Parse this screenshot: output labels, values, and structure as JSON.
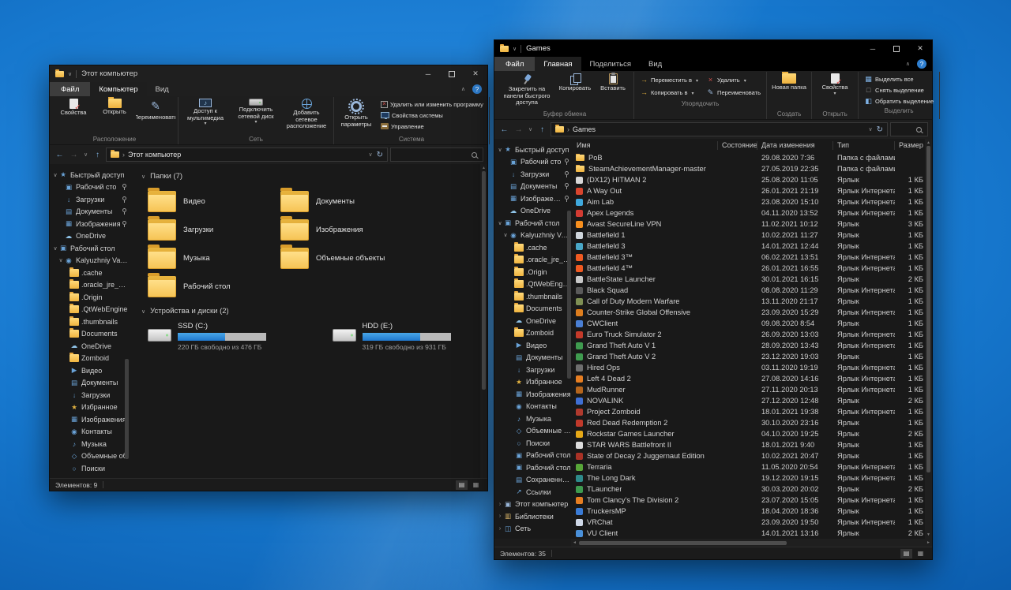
{
  "icons": {
    "back": "←",
    "forward": "→",
    "up": "↑",
    "chevron_down": "∨",
    "chevron_up": "∧",
    "breadcrumb": "›",
    "refresh": "↻",
    "help": "?",
    "minimize": "─",
    "close": "✕",
    "expander": "∨",
    "scroll_up": "▲",
    "scroll_down": "▼",
    "scroll_left": "◄",
    "scroll_right": "►",
    "view_list": "▤",
    "view_thumbs": "▦"
  },
  "left_window": {
    "title": "Этот компьютер",
    "file_tab": "Файл",
    "tabs": [
      {
        "label": "Компьютер",
        "cls": "active"
      },
      {
        "label": "Вид"
      }
    ],
    "ribbon": {
      "location": {
        "label": "Расположение",
        "buttons": [
          {
            "label": "Свойства",
            "icon": "props"
          },
          {
            "label": "Открыть",
            "icon": "openfolder"
          },
          {
            "label": "Переименовать",
            "icon": "rename"
          }
        ]
      },
      "network": {
        "label": "Сеть",
        "buttons": [
          {
            "label": "Доступ к мультимедиа",
            "icon": "media",
            "dd": true
          },
          {
            "label": "Подключить сетевой диск",
            "icon": "mapdrive",
            "dd": true
          },
          {
            "label": "Добавить сетевое расположение",
            "icon": "addnet"
          }
        ]
      },
      "system": {
        "label": "Система",
        "big": {
          "label": "Открыть параметры",
          "icon": "gear"
        },
        "buttons": [
          {
            "label": "Удалить или изменить программу",
            "icon": "uninstall"
          },
          {
            "label": "Свойства системы",
            "icon": "sysprops"
          },
          {
            "label": "Управление",
            "icon": "manage"
          }
        ]
      }
    },
    "address": {
      "breadcrumb": "Этот компьютер"
    },
    "sidebar": [
      {
        "label": "Быстрый доступ",
        "icon": "star",
        "expand": "open",
        "indent": 0
      },
      {
        "label": "Рабочий сто",
        "icon": "desktop",
        "indent": 1,
        "pinned": true
      },
      {
        "label": "Загрузки",
        "icon": "download",
        "indent": 1,
        "pinned": true
      },
      {
        "label": "Документы",
        "icon": "document",
        "indent": 1,
        "pinned": true
      },
      {
        "label": "Изображения",
        "icon": "picture",
        "indent": 1,
        "pinned": true
      },
      {
        "label": "OneDrive",
        "icon": "cloud",
        "indent": 1
      },
      {
        "label": "Рабочий стол",
        "icon": "desktop",
        "expand": "open",
        "indent": 0
      },
      {
        "label": "Kalyuzhniy Vadim",
        "icon": "user",
        "expand": "open",
        "indent": 1
      },
      {
        "label": ".cache",
        "icon": "folder",
        "indent": 2
      },
      {
        "label": ".oracle_jre_usa",
        "icon": "folder",
        "indent": 2
      },
      {
        "label": ".Origin",
        "icon": "folder",
        "indent": 2
      },
      {
        "label": ".QtWebEngine",
        "icon": "folder",
        "indent": 2
      },
      {
        "label": ".thumbnails",
        "icon": "folder",
        "indent": 2
      },
      {
        "label": "Documents",
        "icon": "folder",
        "indent": 2
      },
      {
        "label": "OneDrive",
        "icon": "cloud",
        "indent": 2
      },
      {
        "label": "Zomboid",
        "icon": "folder",
        "indent": 2
      },
      {
        "label": "Видео",
        "icon": "videos",
        "indent": 2
      },
      {
        "label": "Документы",
        "icon": "document",
        "indent": 2
      },
      {
        "label": "Загрузки",
        "icon": "download",
        "indent": 2
      },
      {
        "label": "Избранное",
        "icon": "favstar",
        "indent": 2
      },
      {
        "label": "Изображения",
        "icon": "picture",
        "indent": 2
      },
      {
        "label": "Контакты",
        "icon": "contacts",
        "indent": 2
      },
      {
        "label": "Музыка",
        "icon": "music",
        "indent": 2
      },
      {
        "label": "Объемные об",
        "icon": "objects3d",
        "indent": 2
      },
      {
        "label": "Поиски",
        "icon": "search",
        "indent": 2
      }
    ],
    "content": {
      "folders_header": "Папки (7)",
      "folders": [
        "Видео",
        "Документы",
        "Загрузки",
        "Изображения",
        "Музыка",
        "Объемные объекты",
        "Рабочий стол"
      ],
      "drives_header": "Устройства и диски (2)",
      "drives": [
        {
          "name": "SSD (C:)",
          "used": "54%",
          "info": "220 ГБ свободно из 476 ГБ"
        },
        {
          "name": "HDD (E:)",
          "used": "66%",
          "info": "319 ГБ свободно из 931 ГБ"
        }
      ]
    },
    "status": "Элементов: 9"
  },
  "right_window": {
    "title": "Games",
    "file_tab": "Файл",
    "tabs": [
      {
        "label": "Главная",
        "cls": "active"
      },
      {
        "label": "Поделиться"
      },
      {
        "label": "Вид"
      }
    ],
    "ribbon": {
      "clipboard": {
        "label": "Буфер обмена",
        "buttons": [
          {
            "label": "Закрепить на панели быстрого доступа",
            "icon": "pin",
            "cls": "wide"
          },
          {
            "label": "Копировать",
            "icon": "copy"
          },
          {
            "label": "Вставить",
            "icon": "paste"
          }
        ]
      },
      "organize": {
        "label": "Упорядочить",
        "buttons": [
          {
            "label": "Переместить в",
            "icon": "move",
            "dd": true
          },
          {
            "label": "Копировать в",
            "icon": "copyto",
            "dd": true
          },
          {
            "label": "Удалить",
            "icon": "delete",
            "dd": true
          },
          {
            "label": "Переименовать",
            "icon": "rename"
          }
        ]
      },
      "create": {
        "label": "Создать",
        "buttons": [
          {
            "label": "Новая папка",
            "icon": "newfolder"
          }
        ]
      },
      "open": {
        "label": "Открыть",
        "buttons": [
          {
            "label": "Свойства",
            "icon": "props",
            "dd": true
          }
        ]
      },
      "select": {
        "label": "Выделить",
        "buttons": [
          {
            "label": "Выделить все",
            "icon": "selall"
          },
          {
            "label": "Снять выделение",
            "icon": "selnone"
          },
          {
            "label": "Обратить выделение",
            "icon": "selinv"
          }
        ]
      }
    },
    "address": {
      "breadcrumb": "Games"
    },
    "sidebar": [
      {
        "label": "Быстрый доступ",
        "icon": "star",
        "expand": "open",
        "indent": 0
      },
      {
        "label": "Рабочий сто",
        "icon": "desktop",
        "indent": 1,
        "pinned": true
      },
      {
        "label": "Загрузки",
        "icon": "download",
        "indent": 1,
        "pinned": true
      },
      {
        "label": "Документы",
        "icon": "document",
        "indent": 1,
        "pinned": true
      },
      {
        "label": "Изображения",
        "icon": "picture",
        "indent": 1,
        "pinned": true
      },
      {
        "label": "OneDrive",
        "icon": "cloud",
        "indent": 1
      },
      {
        "label": "Рабочий стол",
        "icon": "desktop",
        "expand": "open",
        "indent": 0
      },
      {
        "label": "Kalyuzhniy Vadim",
        "icon": "user",
        "expand": "open",
        "indent": 1
      },
      {
        "label": ".cache",
        "icon": "folder",
        "indent": 2
      },
      {
        "label": ".oracle_jre_usa",
        "icon": "folder",
        "indent": 2
      },
      {
        "label": ".Origin",
        "icon": "folder",
        "indent": 2
      },
      {
        "label": ".QtWebEngine",
        "icon": "folder",
        "indent": 2
      },
      {
        "label": ".thumbnails",
        "icon": "folder",
        "indent": 2
      },
      {
        "label": "Documents",
        "icon": "folder",
        "indent": 2
      },
      {
        "label": "OneDrive",
        "icon": "cloud",
        "indent": 2
      },
      {
        "label": "Zomboid",
        "icon": "folder",
        "indent": 2
      },
      {
        "label": "Видео",
        "icon": "videos",
        "indent": 2
      },
      {
        "label": "Документы",
        "icon": "document",
        "indent": 2
      },
      {
        "label": "Загрузки",
        "icon": "download",
        "indent": 2
      },
      {
        "label": "Избранное",
        "icon": "favstar",
        "indent": 2
      },
      {
        "label": "Изображения",
        "icon": "picture",
        "indent": 2
      },
      {
        "label": "Контакты",
        "icon": "contacts",
        "indent": 2
      },
      {
        "label": "Музыка",
        "icon": "music",
        "indent": 2
      },
      {
        "label": "Объемные об",
        "icon": "objects3d",
        "indent": 2
      },
      {
        "label": "Поиски",
        "icon": "search",
        "indent": 2
      },
      {
        "label": "Рабочий стол",
        "icon": "desktop",
        "indent": 2
      },
      {
        "label": "Рабочий стол",
        "icon": "desktop",
        "indent": 2
      },
      {
        "label": "Сохраненные",
        "icon": "saved",
        "indent": 2
      },
      {
        "label": "Ссылки",
        "icon": "links",
        "indent": 2
      },
      {
        "label": "Этот компьютер",
        "icon": "pc",
        "expand": "closed",
        "indent": 0
      },
      {
        "label": "Библиотеки",
        "icon": "library",
        "expand": "closed",
        "indent": 0
      },
      {
        "label": "Сеть",
        "icon": "network",
        "expand": "closed",
        "indent": 0
      }
    ],
    "columns": [
      "Имя",
      "Состояние",
      "Дата изменения",
      "Тип",
      "Размер"
    ],
    "files": [
      {
        "name": "PoB",
        "icon": "folder",
        "date": "29.08.2020 7:36",
        "type": "Папка с файлами",
        "size": ""
      },
      {
        "name": "SteamAchievementManager-master",
        "icon": "folder",
        "date": "27.05.2019 22:35",
        "type": "Папка с файлами",
        "size": ""
      },
      {
        "name": "(DX12) HITMAN 2",
        "icon": "block",
        "color": "#d8d8d8",
        "date": "25.08.2020 11:05",
        "type": "Ярлык",
        "size": "1 КБ"
      },
      {
        "name": "A Way Out",
        "icon": "block",
        "color": "#d8452e",
        "date": "26.01.2021 21:19",
        "type": "Ярлык Интернета",
        "size": "1 КБ"
      },
      {
        "name": "Aim Lab",
        "icon": "block",
        "color": "#3fa8dc",
        "date": "23.08.2020 15:10",
        "type": "Ярлык Интернета",
        "size": "1 КБ"
      },
      {
        "name": "Apex Legends",
        "icon": "block",
        "color": "#d23b32",
        "date": "04.11.2020 13:52",
        "type": "Ярлык Интернета",
        "size": "1 КБ"
      },
      {
        "name": "Avast SecureLine VPN",
        "icon": "block",
        "color": "#f78f1e",
        "date": "11.02.2021 10:12",
        "type": "Ярлык",
        "size": "3 КБ"
      },
      {
        "name": "Battlefield 1",
        "icon": "block",
        "color": "#cfd6dc",
        "date": "10.02.2021 11:27",
        "type": "Ярлык",
        "size": "1 КБ"
      },
      {
        "name": "Battlefield 3",
        "icon": "block",
        "color": "#49a7c7",
        "date": "14.01.2021 12:44",
        "type": "Ярлык",
        "size": "1 КБ"
      },
      {
        "name": "Battlefield 3™",
        "icon": "block",
        "color": "#f05a22",
        "date": "06.02.2021 13:51",
        "type": "Ярлык Интернета",
        "size": "1 КБ"
      },
      {
        "name": "Battlefield 4™",
        "icon": "block",
        "color": "#f05a22",
        "date": "26.01.2021 16:55",
        "type": "Ярлык Интернета",
        "size": "1 КБ"
      },
      {
        "name": "BattleState Launcher",
        "icon": "block",
        "color": "#c9c9c9",
        "date": "30.01.2021 16:15",
        "type": "Ярлык",
        "size": "2 КБ"
      },
      {
        "name": "Black Squad",
        "icon": "block",
        "color": "#5a5a5a",
        "date": "08.08.2020 11:29",
        "type": "Ярлык Интернета",
        "size": "1 КБ"
      },
      {
        "name": "Call of Duty Modern Warfare",
        "icon": "block",
        "color": "#7e8f54",
        "date": "13.11.2020 21:17",
        "type": "Ярлык",
        "size": "1 КБ"
      },
      {
        "name": "Counter-Strike Global Offensive",
        "icon": "block",
        "color": "#de7e1e",
        "date": "23.09.2020 15:29",
        "type": "Ярлык Интернета",
        "size": "1 КБ"
      },
      {
        "name": "CWClient",
        "icon": "block",
        "color": "#4a7fd4",
        "date": "09.08.2020 8:54",
        "type": "Ярлык",
        "size": "1 КБ"
      },
      {
        "name": "Euro Truck Simulator 2",
        "icon": "block",
        "color": "#c43a2a",
        "date": "26.09.2020 13:03",
        "type": "Ярлык Интернета",
        "size": "1 КБ"
      },
      {
        "name": "Grand Theft Auto V 1",
        "icon": "block",
        "color": "#3f9b4f",
        "date": "28.09.2020 13:43",
        "type": "Ярлык Интернета",
        "size": "1 КБ"
      },
      {
        "name": "Grand Theft Auto V 2",
        "icon": "block",
        "color": "#3f9b4f",
        "date": "23.12.2020 19:03",
        "type": "Ярлык",
        "size": "1 КБ"
      },
      {
        "name": "Hired Ops",
        "icon": "block",
        "color": "#6e6e6e",
        "date": "03.11.2020 19:19",
        "type": "Ярлык Интернета",
        "size": "1 КБ"
      },
      {
        "name": "Left 4 Dead 2",
        "icon": "block",
        "color": "#e67e22",
        "date": "27.08.2020 14:16",
        "type": "Ярлык Интернета",
        "size": "1 КБ"
      },
      {
        "name": "MudRunner",
        "icon": "block",
        "color": "#b5651d",
        "date": "27.11.2020 20:13",
        "type": "Ярлык Интернета",
        "size": "1 КБ"
      },
      {
        "name": "NOVALINK",
        "icon": "block",
        "color": "#3f6fd4",
        "date": "27.12.2020 12:48",
        "type": "Ярлык",
        "size": "2 КБ"
      },
      {
        "name": "Project Zomboid",
        "icon": "block",
        "color": "#b03a2e",
        "date": "18.01.2021 19:38",
        "type": "Ярлык Интернета",
        "size": "1 КБ"
      },
      {
        "name": "Red Dead Redemption 2",
        "icon": "block",
        "color": "#c0392b",
        "date": "30.10.2020 23:16",
        "type": "Ярлык",
        "size": "1 КБ"
      },
      {
        "name": "Rockstar Games Launcher",
        "icon": "block",
        "color": "#e6a817",
        "date": "04.10.2020 19:25",
        "type": "Ярлык",
        "size": "2 КБ"
      },
      {
        "name": "STAR WARS Battlefront II",
        "icon": "block",
        "color": "#dcdcdc",
        "date": "18.01.2021 9:40",
        "type": "Ярлык",
        "size": "1 КБ"
      },
      {
        "name": "State of Decay 2 Juggernaut Edition",
        "icon": "block",
        "color": "#a93226",
        "date": "10.02.2021 20:47",
        "type": "Ярлык",
        "size": "1 КБ"
      },
      {
        "name": "Terraria",
        "icon": "block",
        "color": "#57a639",
        "date": "11.05.2020 20:54",
        "type": "Ярлык Интернета",
        "size": "1 КБ"
      },
      {
        "name": "The Long Dark",
        "icon": "block",
        "color": "#2e8b8b",
        "date": "19.12.2020 19:15",
        "type": "Ярлык Интернета",
        "size": "1 КБ"
      },
      {
        "name": "TLauncher",
        "icon": "block",
        "color": "#3f9b4f",
        "date": "30.03.2020 20:02",
        "type": "Ярлык",
        "size": "2 КБ"
      },
      {
        "name": "Tom Clancy's The Division 2",
        "icon": "block",
        "color": "#e67e22",
        "date": "23.07.2020 15:05",
        "type": "Ярлык Интернета",
        "size": "1 КБ"
      },
      {
        "name": "TruckersMP",
        "icon": "block",
        "color": "#3a7bd5",
        "date": "18.04.2020 18:36",
        "type": "Ярлык",
        "size": "1 КБ"
      },
      {
        "name": "VRChat",
        "icon": "block",
        "color": "#cfd8e8",
        "date": "23.09.2020 19:50",
        "type": "Ярлык Интернета",
        "size": "1 КБ"
      },
      {
        "name": "VU Client",
        "icon": "block",
        "color": "#4a90d9",
        "date": "14.01.2021 13:16",
        "type": "Ярлык",
        "size": "2 КБ"
      }
    ],
    "status": "Элементов: 35"
  }
}
